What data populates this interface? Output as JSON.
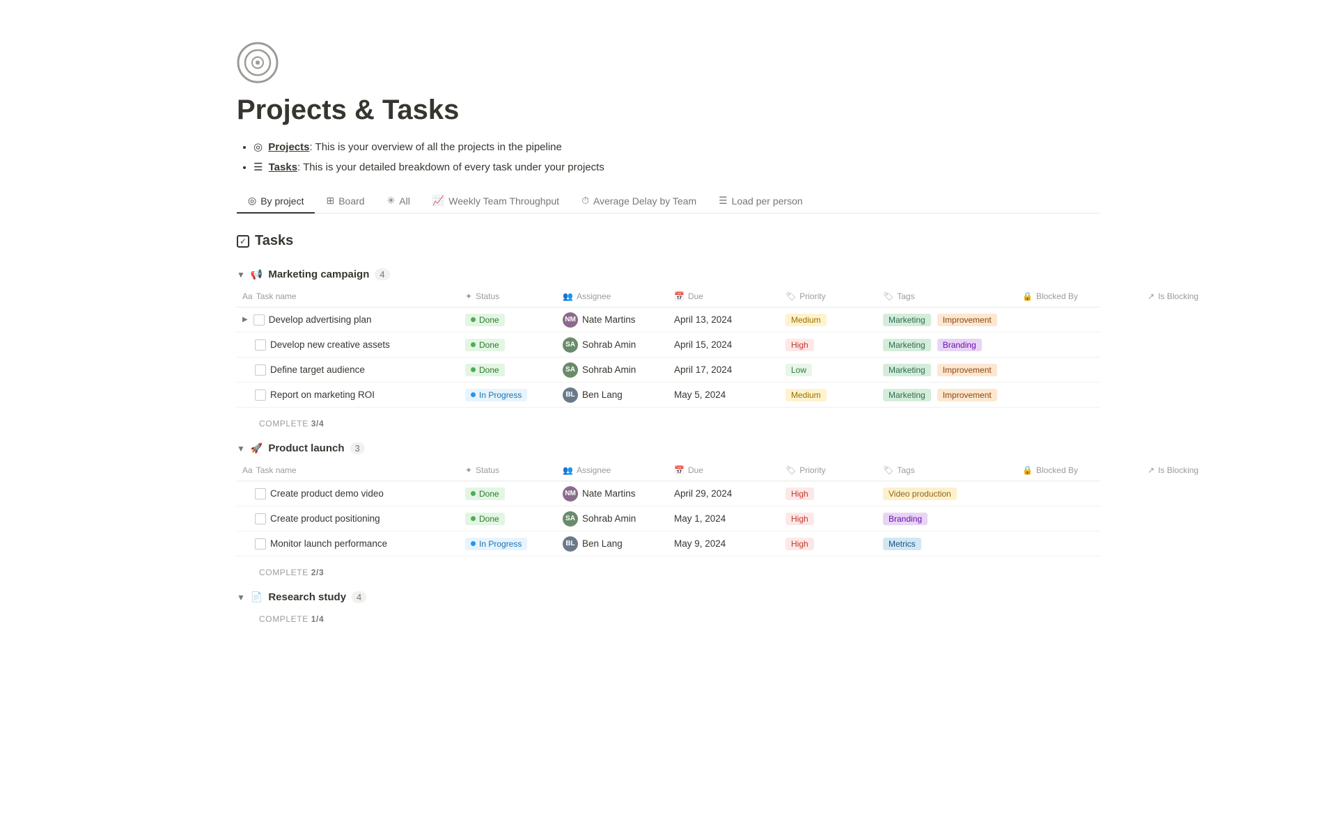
{
  "page": {
    "title": "Projects & Tasks",
    "bullets": [
      {
        "label": "Projects",
        "text": ": This is your overview of all the projects in the pipeline"
      },
      {
        "label": "Tasks",
        "text": ": This is your detailed breakdown of every task under your projects"
      }
    ]
  },
  "tabs": [
    {
      "id": "by-project",
      "label": "By project",
      "icon": "◎",
      "active": true
    },
    {
      "id": "board",
      "label": "Board",
      "icon": "⊞",
      "active": false
    },
    {
      "id": "all",
      "label": "All",
      "icon": "✳",
      "active": false
    },
    {
      "id": "weekly-throughput",
      "label": "Weekly Team Throughput",
      "icon": "📈",
      "active": false
    },
    {
      "id": "avg-delay",
      "label": "Average Delay by Team",
      "icon": "⏱",
      "active": false
    },
    {
      "id": "load-per-person",
      "label": "Load per person",
      "icon": "☰",
      "active": false
    }
  ],
  "tasks_section": {
    "heading": "Tasks"
  },
  "columns": {
    "task_name": "Task name",
    "status": "Status",
    "assignee": "Assignee",
    "due": "Due",
    "priority": "Priority",
    "tags": "Tags",
    "blocked_by": "Blocked By",
    "is_blocking": "Is Blocking"
  },
  "groups": [
    {
      "id": "marketing-campaign",
      "icon": "📢",
      "name": "Marketing campaign",
      "count": 4,
      "complete_text": "COMPLETE",
      "complete_fraction": "3/4",
      "tasks": [
        {
          "name": "Develop advertising plan",
          "has_expand": true,
          "status": "Done",
          "status_type": "done",
          "assignee": "Nate Martins",
          "assignee_initials": "NM",
          "assignee_class": "avatar-nm",
          "due": "April 13, 2024",
          "priority": "Medium",
          "priority_class": "priority-medium",
          "tags": [
            {
              "label": "Marketing",
              "class": "tag-marketing"
            },
            {
              "label": "Improvement",
              "class": "tag-improvement"
            }
          ]
        },
        {
          "name": "Develop new creative assets",
          "has_expand": false,
          "status": "Done",
          "status_type": "done",
          "assignee": "Sohrab Amin",
          "assignee_initials": "SA",
          "assignee_class": "avatar-sa",
          "due": "April 15, 2024",
          "priority": "High",
          "priority_class": "priority-high",
          "tags": [
            {
              "label": "Marketing",
              "class": "tag-marketing"
            },
            {
              "label": "Branding",
              "class": "tag-branding"
            }
          ]
        },
        {
          "name": "Define target audience",
          "has_expand": false,
          "status": "Done",
          "status_type": "done",
          "assignee": "Sohrab Amin",
          "assignee_initials": "SA",
          "assignee_class": "avatar-sa",
          "due": "April 17, 2024",
          "priority": "Low",
          "priority_class": "priority-low",
          "tags": [
            {
              "label": "Marketing",
              "class": "tag-marketing"
            },
            {
              "label": "Improvement",
              "class": "tag-improvement"
            }
          ]
        },
        {
          "name": "Report on marketing ROI",
          "has_expand": false,
          "status": "In Progress",
          "status_type": "inprogress",
          "assignee": "Ben Lang",
          "assignee_initials": "BL",
          "assignee_class": "avatar-bl",
          "due": "May 5, 2024",
          "priority": "Medium",
          "priority_class": "priority-medium",
          "tags": [
            {
              "label": "Marketing",
              "class": "tag-marketing"
            },
            {
              "label": "Improvement",
              "class": "tag-improvement"
            }
          ]
        }
      ]
    },
    {
      "id": "product-launch",
      "icon": "🚀",
      "name": "Product launch",
      "count": 3,
      "complete_text": "COMPLETE",
      "complete_fraction": "2/3",
      "tasks": [
        {
          "name": "Create product demo video",
          "has_expand": false,
          "status": "Done",
          "status_type": "done",
          "assignee": "Nate Martins",
          "assignee_initials": "NM",
          "assignee_class": "avatar-nm",
          "due": "April 29, 2024",
          "priority": "High",
          "priority_class": "priority-high",
          "tags": [
            {
              "label": "Video production",
              "class": "tag-video"
            }
          ]
        },
        {
          "name": "Create product positioning",
          "has_expand": false,
          "status": "Done",
          "status_type": "done",
          "assignee": "Sohrab Amin",
          "assignee_initials": "SA",
          "assignee_class": "avatar-sa",
          "due": "May 1, 2024",
          "priority": "High",
          "priority_class": "priority-high",
          "tags": [
            {
              "label": "Branding",
              "class": "tag-branding"
            }
          ]
        },
        {
          "name": "Monitor launch performance",
          "has_expand": false,
          "status": "In Progress",
          "status_type": "inprogress",
          "assignee": "Ben Lang",
          "assignee_initials": "BL",
          "assignee_class": "avatar-bl",
          "due": "May 9, 2024",
          "priority": "High",
          "priority_class": "priority-high",
          "tags": [
            {
              "label": "Metrics",
              "class": "tag-metrics"
            }
          ]
        }
      ]
    },
    {
      "id": "research-study",
      "icon": "📄",
      "name": "Research study",
      "count": 4,
      "complete_text": "COMPLETE",
      "complete_fraction": "1/4",
      "tasks": []
    }
  ]
}
